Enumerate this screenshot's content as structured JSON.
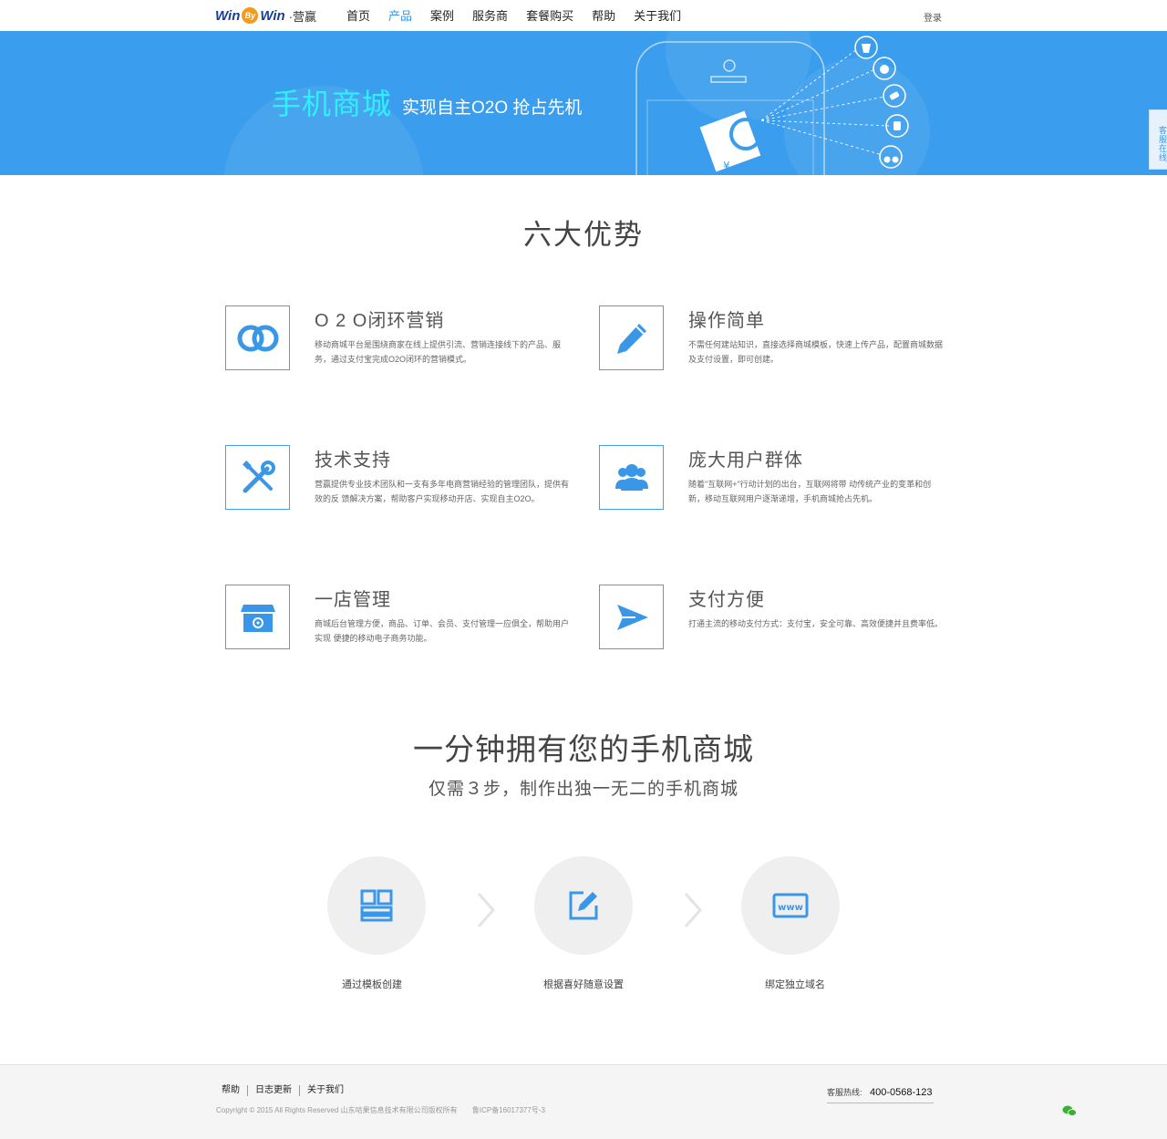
{
  "header": {
    "logo_text_1": "Win",
    "logo_by": "By",
    "logo_text_2": "Win",
    "logo_cn": "·营赢",
    "nav": [
      "首页",
      "产品",
      "案例",
      "服务商",
      "套餐购买",
      "帮助",
      "关于我们"
    ],
    "active_nav": "产品",
    "login": "登录"
  },
  "banner": {
    "title": "手机商城",
    "subtitle": "实现自主O2O 抢占先机",
    "currency_symbol": "¥"
  },
  "service_tab": "客服在线",
  "advantages": {
    "title": "六大优势",
    "items": [
      {
        "icon": "rings-icon",
        "title": "O 2 O闭环营销",
        "desc": "移动商城平台是围绕商家在线上提供引流、营销连接线下的产品、服务，通过支付宝完成O2O闭环的营销模式。"
      },
      {
        "icon": "pencil-icon",
        "title": "操作简单",
        "desc": "不需任何建站知识，直接选择商城模板，快速上传产品，配置商城数据及支付设置，即可创建。"
      },
      {
        "icon": "tools-icon",
        "title": "技术支持",
        "desc": "营赢提供专业技术团队和一支有多年电商营销经验的管理团队，提供有效的反 馈解决方案，帮助客户实现移动开店、实现自主O2O。"
      },
      {
        "icon": "users-icon",
        "title": "庞大用户群体",
        "desc": "随着\"互联网+\"行动计划的出台，互联网将带 动传统产业的变革和创新，移动互联网用户逐渐递增，手机商城抢占先机。"
      },
      {
        "icon": "store-icon",
        "title": "一店管理",
        "desc": "商城后台管理方便，商品、订单、会员、支付管理一应俱全，帮助用户实现 便捷的移动电子商务功能。"
      },
      {
        "icon": "send-icon",
        "title": "支付方便",
        "desc": "打通主流的移动支付方式：支付宝，安全可靠、高效便捷并且费率低。"
      }
    ]
  },
  "steps": {
    "title": "一分钟拥有您的手机商城",
    "subtitle": "仅需３步，制作出独一无二的手机商城",
    "items": [
      {
        "icon": "template-icon",
        "label": "通过模板创建"
      },
      {
        "icon": "edit-icon",
        "label": "根据喜好随意设置"
      },
      {
        "icon": "www-icon",
        "label": "绑定独立域名"
      }
    ],
    "www_text": "www"
  },
  "footer": {
    "links": [
      "帮助",
      "日志更新",
      "关于我们"
    ],
    "copyright": "Copyright © 2015 All Rights Reserved 山东咕果信息技术有限公司版权所有",
    "icp": "鲁ICP备16017377号-3",
    "hotline_label": "客服热线:",
    "hotline_number": "400-0568-123"
  },
  "colors": {
    "accent": "#3a97e8",
    "banner_bg": "#3a9ded",
    "banner_title": "#2ef0ff"
  }
}
